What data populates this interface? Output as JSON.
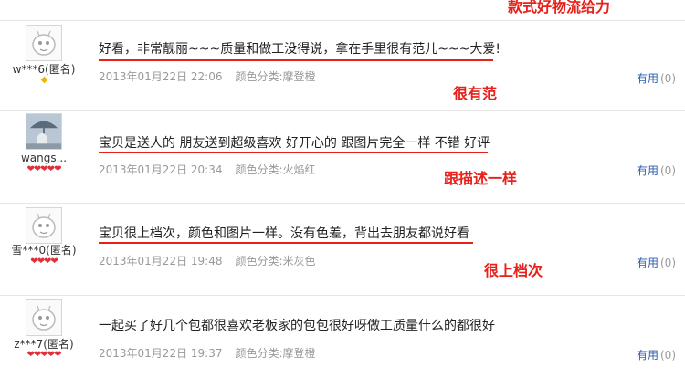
{
  "annotations": [
    "款式好物流给力",
    "很有范",
    "跟描述一样",
    "很上档次"
  ],
  "reviews": [
    {
      "user": "w***6(匿名)",
      "badge": "◆",
      "avatar": "default-avatar",
      "content": "好看，非常靓丽~~~质量和做工没得说，拿在手里很有范儿~~~大爱!",
      "date": "2013年01月22日 22:06",
      "color": "颜色分类:摩登橙",
      "useful_label": "有用",
      "useful_count": "(0)"
    },
    {
      "user": "wangs...",
      "badge": "❤❤❤❤❤",
      "avatar": "umbrella-photo-avatar",
      "content": "宝贝是送人的 朋友送到超级喜欢 好开心的 跟图片完全一样 不错 好评",
      "date": "2013年01月22日 20:34",
      "color": "颜色分类:火焰红",
      "useful_label": "有用",
      "useful_count": "(0)"
    },
    {
      "user": "雪***0(匿名)",
      "badge": "❤❤❤❤",
      "avatar": "default-avatar",
      "content": "宝贝很上档次，颜色和图片一样。没有色差，背出去朋友都说好看",
      "date": "2013年01月22日 19:48",
      "color": "颜色分类:米灰色",
      "useful_label": "有用",
      "useful_count": "(0)"
    },
    {
      "user": "z***7(匿名)",
      "badge": "❤❤❤❤❤",
      "avatar": "default-avatar",
      "content": "一起买了好几个包都很喜欢老板家的包包很好呀做工质量什么的都很好",
      "date": "2013年01月22日 19:37",
      "color": "颜色分类:摩登橙",
      "useful_label": "有用",
      "useful_count": "(0)"
    }
  ],
  "colors": {
    "annotation": "#e8201a",
    "link": "#2a5db0",
    "meta": "#999999",
    "heart": "#e0303a",
    "diamond": "#f2b400"
  }
}
